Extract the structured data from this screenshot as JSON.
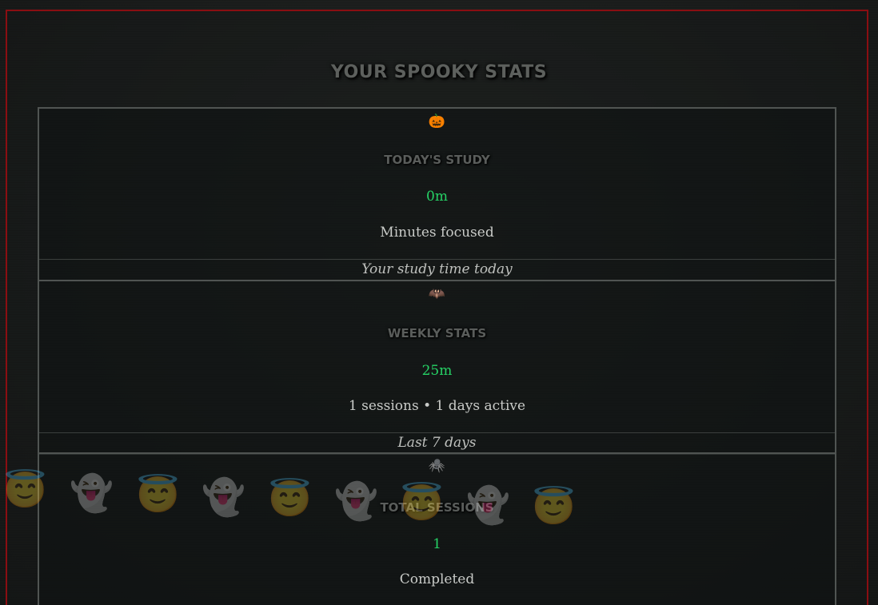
{
  "page": {
    "title": "Your Spooky Stats"
  },
  "cards": [
    {
      "icon": "🎃",
      "icon_name": "pumpkin-icon",
      "heading": "Today's Study",
      "value": "0m",
      "subtitle": "Minutes focused",
      "footer": "Your study time today"
    },
    {
      "icon": "🦇",
      "icon_name": "bat-icon",
      "heading": "Weekly Stats",
      "value": "25m",
      "subtitle": "1 sessions • 1 days active",
      "footer": "Last 7 days"
    },
    {
      "icon": "🕷️",
      "icon_name": "spider-icon",
      "heading": "Total Sessions",
      "value": "1",
      "subtitle": "Completed"
    }
  ],
  "decorations": {
    "floating_icons": [
      "😇",
      "👻",
      "😇",
      "👻",
      "😇",
      "👻",
      "😇",
      "👻",
      "😇"
    ]
  },
  "colors": {
    "frame_border": "#8a0e12",
    "value_green": "#26d366",
    "card_border": "#505452",
    "background": "#1b1d1c"
  }
}
